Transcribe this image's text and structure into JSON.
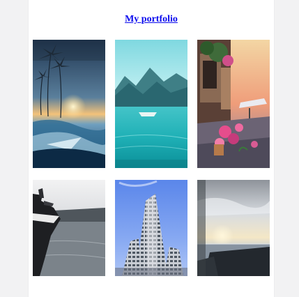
{
  "header": {
    "title_link": "My portfolio"
  },
  "gallery": {
    "items": [
      {
        "name": "sunset-beach-palms-photo"
      },
      {
        "name": "turquoise-lake-mountains-photo"
      },
      {
        "name": "flower-street-cafe-photo"
      },
      {
        "name": "boat-misty-lake-photo"
      },
      {
        "name": "tall-building-blue-sky-photo"
      },
      {
        "name": "cloudy-sea-rocks-photo"
      }
    ]
  },
  "colors": {
    "link": "#0a0aee",
    "page_background": "#ffffff",
    "outer_background": "#f2f2f3"
  }
}
